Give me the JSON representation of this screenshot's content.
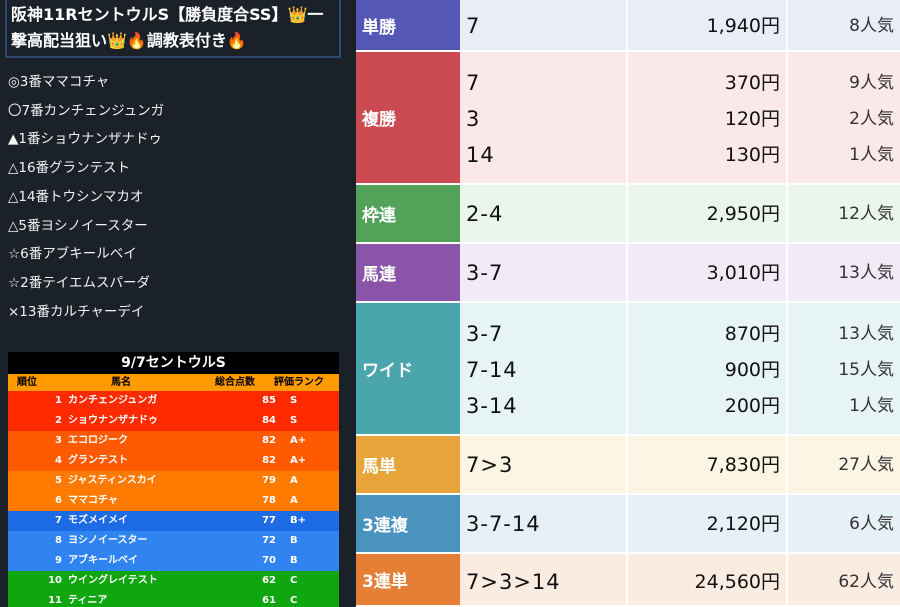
{
  "left": {
    "title_line1": "阪神11RセントウルS【勝負度合SS】👑一",
    "title_line2": "撃高配当狙い👑🔥調教表付き🔥",
    "picks": [
      "◎3番ママコチャ",
      "〇7番カンチェンジュンガ",
      "▲1番ショウナンザナドゥ",
      "△16番グランテスト",
      "△14番トウシンマカオ",
      "△5番ヨシノイースター",
      "☆6番アブキールベイ",
      "☆2番テイエムスパーダ",
      "×13番カルチャーデイ"
    ],
    "rank_table": {
      "title": "9/7セントウルS",
      "headers": [
        "順位",
        "馬名",
        "総合点数",
        "評価ランク"
      ],
      "rows": [
        {
          "rank": "1",
          "name": "カンチェンジュンガ",
          "score": "85",
          "grade": "S",
          "color": "#ff2a00"
        },
        {
          "rank": "2",
          "name": "ショウナンザナドゥ",
          "score": "84",
          "grade": "S",
          "color": "#ff2a00"
        },
        {
          "rank": "3",
          "name": "エコロジーク",
          "score": "82",
          "grade": "A+",
          "color": "#ff5a00"
        },
        {
          "rank": "4",
          "name": "グランテスト",
          "score": "82",
          "grade": "A+",
          "color": "#ff5a00"
        },
        {
          "rank": "5",
          "name": "ジャスティンスカイ",
          "score": "79",
          "grade": "A",
          "color": "#ff7a00"
        },
        {
          "rank": "6",
          "name": "ママコチャ",
          "score": "78",
          "grade": "A",
          "color": "#ff7a00"
        },
        {
          "rank": "7",
          "name": "モズメイメイ",
          "score": "77",
          "grade": "B+",
          "color": "#1e6be6"
        },
        {
          "rank": "8",
          "name": "ヨシノイースター",
          "score": "72",
          "grade": "B",
          "color": "#2f84f2"
        },
        {
          "rank": "9",
          "name": "アブキールベイ",
          "score": "70",
          "grade": "B",
          "color": "#2f84f2"
        },
        {
          "rank": "10",
          "name": "ウイングレイテスト",
          "score": "62",
          "grade": "C",
          "color": "#0fa60f"
        },
        {
          "rank": "11",
          "name": "ティニア",
          "score": "61",
          "grade": "C",
          "color": "#0fa60f"
        }
      ]
    }
  },
  "payouts": [
    {
      "label": "単勝",
      "label_color": "#5457b6",
      "bg": "#e9edf8",
      "rows": [
        {
          "combo": "7",
          "yen": "1,940円",
          "pop": "8人気"
        }
      ]
    },
    {
      "label": "複勝",
      "label_color": "#cc4b52",
      "bg": "#fbe9ea",
      "rows": [
        {
          "combo": "7",
          "yen": "370円",
          "pop": "9人気"
        },
        {
          "combo": "3",
          "yen": "120円",
          "pop": "2人気"
        },
        {
          "combo": "14",
          "yen": "130円",
          "pop": "1人気"
        }
      ]
    },
    {
      "label": "枠連",
      "label_color": "#52a359",
      "bg": "#eaf6eb",
      "rows": [
        {
          "combo": "2-4",
          "yen": "2,950円",
          "pop": "12人気"
        }
      ]
    },
    {
      "label": "馬連",
      "label_color": "#8a55a8",
      "bg": "#f3eaf8",
      "rows": [
        {
          "combo": "3-7",
          "yen": "3,010円",
          "pop": "13人気"
        }
      ]
    },
    {
      "label": "ワイド",
      "label_color": "#4aa5ad",
      "bg": "#e6f4f5",
      "rows": [
        {
          "combo": "3-7",
          "yen": "870円",
          "pop": "13人気"
        },
        {
          "combo": "7-14",
          "yen": "900円",
          "pop": "15人気"
        },
        {
          "combo": "3-14",
          "yen": "200円",
          "pop": "1人気"
        }
      ]
    },
    {
      "label": "馬単",
      "label_color": "#e6a43a",
      "bg": "#fcf5e4",
      "rows": [
        {
          "combo": "7>3",
          "yen": "7,830円",
          "pop": "27人気"
        }
      ]
    },
    {
      "label": "3連複",
      "label_color": "#4a93bf",
      "bg": "#e6f0f7",
      "rows": [
        {
          "combo": "3-7-14",
          "yen": "2,120円",
          "pop": "6人気"
        }
      ]
    },
    {
      "label": "3連単",
      "label_color": "#e67f36",
      "bg": "#fbece2",
      "rows": [
        {
          "combo": "7>3>14",
          "yen": "24,560円",
          "pop": "62人気"
        }
      ]
    }
  ]
}
